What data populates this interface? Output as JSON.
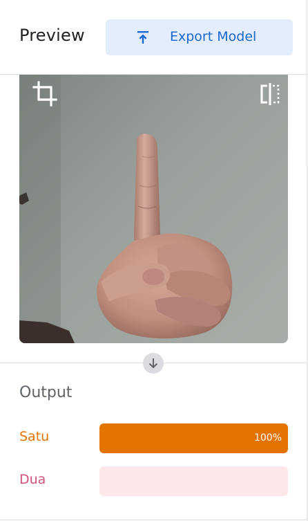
{
  "header": {
    "title": "Preview",
    "export_button_label": "Export Model",
    "export_icon": "upload-icon"
  },
  "preview": {
    "crop_icon": "crop-icon",
    "flip_icon": "flip-icon"
  },
  "divider_icon": "arrow-down-icon",
  "output": {
    "title": "Output",
    "classes": [
      {
        "label": "Satu",
        "value_label": "100%",
        "confidence": 1.0,
        "label_color": "#e37400",
        "bar_color": "#e37400",
        "track_color": "#fce8d6"
      },
      {
        "label": "Dua",
        "value_label": "",
        "confidence": 0.0,
        "label_color": "#d0527a",
        "bar_color": "#d0527a",
        "track_color": "#fde7ea"
      }
    ]
  }
}
